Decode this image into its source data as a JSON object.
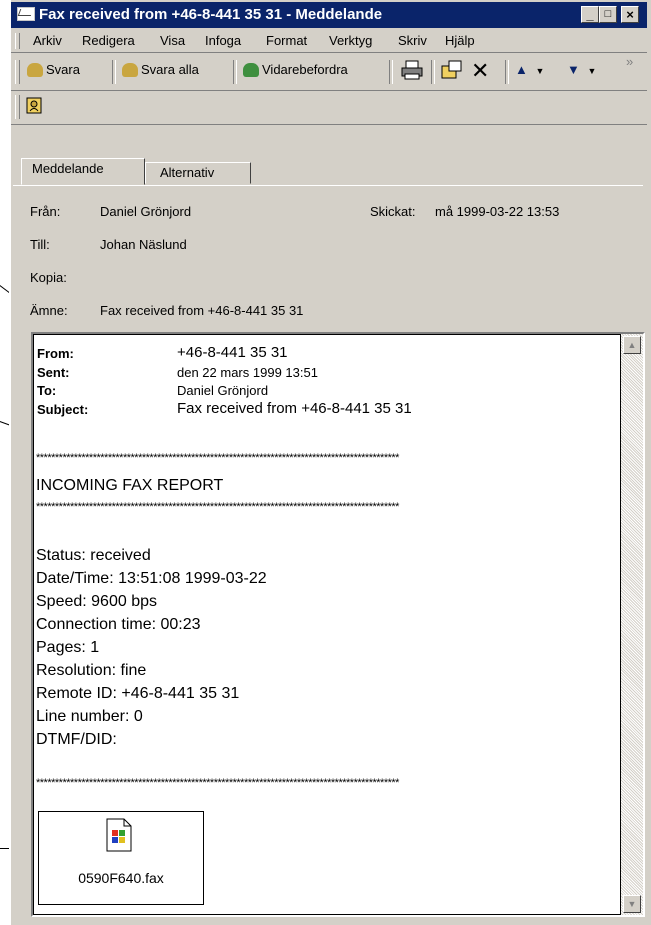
{
  "window": {
    "title": "Fax received from +46-8-441 35 31 - Meddelande",
    "caption_buttons": [
      "_",
      "□",
      "×"
    ]
  },
  "menu": [
    "Arkiv",
    "Redigera",
    "Visa",
    "Infoga",
    "Format",
    "Verktyg",
    "Skriv",
    "Hjälp"
  ],
  "toolbar": {
    "reply": "Svara",
    "reply_all": "Svara alla",
    "forward": "Vidarebefordra",
    "more": "»"
  },
  "tabs": [
    "Meddelande",
    "Alternativ"
  ],
  "header": {
    "from_label": "Från:",
    "from_value": "Daniel Grönjord",
    "sent_label": "Skickat:",
    "sent_value": "må 1999-03-22 13:53",
    "to_label": "Till:",
    "to_value": "Johan Näslund",
    "cc_label": "Kopia:",
    "subject_label": "Ämne:",
    "subject_value": "Fax received from +46-8-441 35 31"
  },
  "message": {
    "from_label": "From:",
    "from_value": "+46-8-441 35 31",
    "sent_label": "Sent:",
    "sent_value": "den 22 mars 1999 13:51",
    "to_label": "To:",
    "to_value": "Daniel Grönjord",
    "subject_label": "Subject:",
    "subject_value": "Fax received from +46-8-441 35 31",
    "stars": "************************************************************************************************",
    "report_title": "INCOMING FAX REPORT",
    "lines": [
      "Status: received",
      "Date/Time: 13:51:08 1999-03-22",
      "Speed: 9600 bps",
      "Connection time: 00:23",
      "Pages: 1",
      "Resolution: fine",
      "Remote ID: +46-8-441 35 31",
      "Line number: 0",
      "DTMF/DID:"
    ]
  },
  "attachment": {
    "filename": "0590F640.fax"
  }
}
